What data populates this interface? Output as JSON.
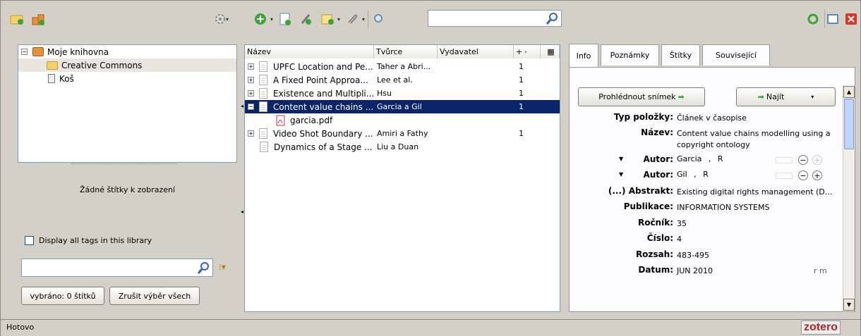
{
  "toolbar": {
    "left_icons": [
      "new-collection-icon",
      "new-group-icon",
      "actions-gear-icon"
    ],
    "mid_icons": [
      "new-item-icon",
      "add-by-identifier-icon",
      "remove-item-icon",
      "new-note-icon",
      "attach-icon",
      "advanced-search-icon"
    ],
    "search_value": "",
    "right_icons": [
      "sync-icon",
      "fullscreen-icon",
      "close-icon"
    ]
  },
  "collections": {
    "items": [
      {
        "label": "Moje knihovna"
      },
      {
        "label": "Creative Commons"
      },
      {
        "label": "Koš"
      }
    ]
  },
  "tags": {
    "empty_text": "Žádné štítky k zobrazení",
    "display_all_label": "Display all tags in this library",
    "filter_value": "",
    "selected_count": "vybráno: 0 štítků",
    "deselect_all": "Zrušit výběr všech"
  },
  "items": {
    "columns": [
      "Název",
      "Tvůrce",
      "Vydavatel",
      "+"
    ],
    "rows": [
      {
        "title": "UPFC Location and Pe...",
        "creator": "Taher a Abri...",
        "count": "1"
      },
      {
        "title": "A Fixed Point Approa...",
        "creator": "Lee et al.",
        "count": "1"
      },
      {
        "title": "Existence and Multipli...",
        "creator": "Hsu",
        "count": "1"
      },
      {
        "title": "Content value chains ...",
        "creator": "Garcia a Gil",
        "count": "1"
      },
      {
        "title": "garcia.pdf",
        "creator": "",
        "count": ""
      },
      {
        "title": "Video Shot Boundary ...",
        "creator": "Amiri a Fathy",
        "count": "1"
      },
      {
        "title": "Dynamics of a Stage ...",
        "creator": "Liu a Duan",
        "count": ""
      }
    ]
  },
  "info": {
    "tabs": [
      "Info",
      "Poznámky",
      "Štítky",
      "Související"
    ],
    "view_snapshot": "Prohlédnout snímek",
    "locate": "Najít",
    "fields": {
      "type_label": "Typ položky:",
      "type_value": "Článek v časopise",
      "title_label": "Název:",
      "title_value1": "Content value chains modelling using a",
      "title_value2": "copyright ontology",
      "author_label": "Autor:",
      "author1_last": "Garcia",
      "author1_first": "R",
      "author2_last": "Gil",
      "author2_first": "R",
      "abstract_label": "(...) Abstrakt:",
      "abstract_value": "Existing digital rights management (D...",
      "pub_label": "Publikace:",
      "pub_value": "INFORMATION SYSTEMS",
      "vol_label": "Ročník:",
      "vol_value": "35",
      "issue_label": "Číslo:",
      "issue_value": "4",
      "pages_label": "Rozsah:",
      "pages_value": "483-495",
      "date_label": "Datum:",
      "date_value": "JUN 2010",
      "date_hint": "r  m"
    }
  },
  "status": {
    "text": "Hotovo",
    "brand": "zotero"
  },
  "colors": {
    "selection": "#0a246a",
    "accent_green": "#3aa536"
  }
}
